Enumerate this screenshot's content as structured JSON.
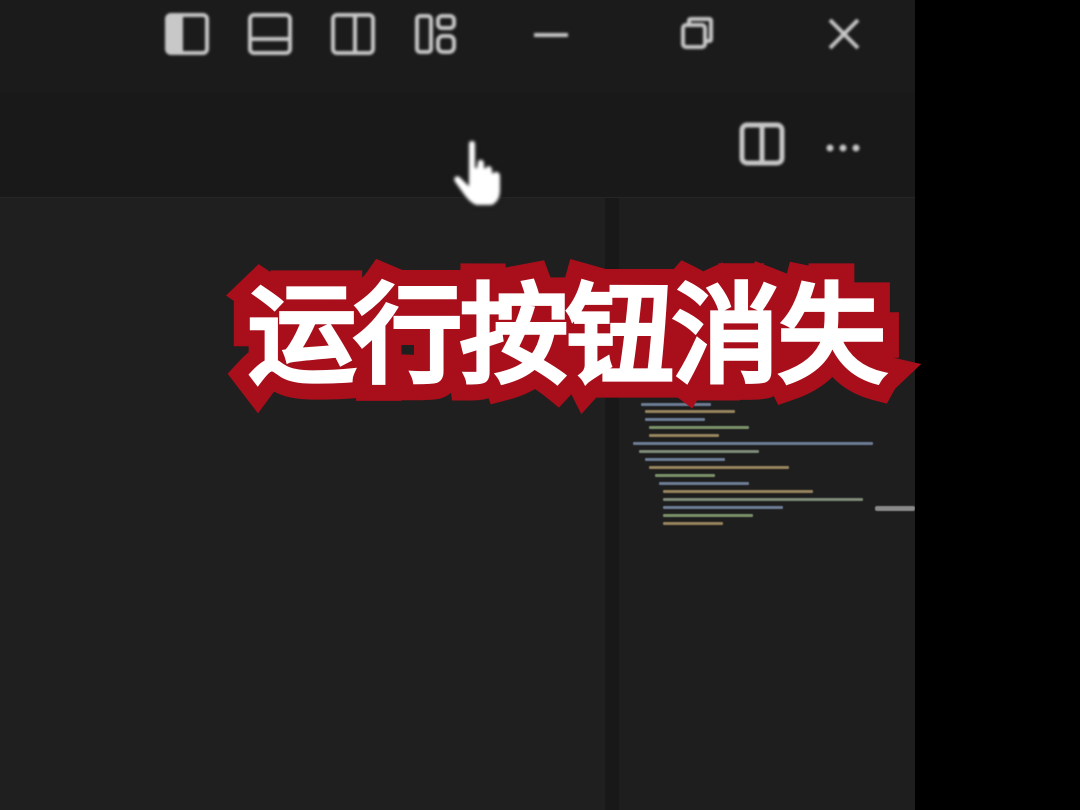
{
  "caption": {
    "text": "运行按钮消失",
    "fill_color": "#ffffff",
    "outline_color": "#a80f1b"
  },
  "window_controls": {
    "icons": [
      "toggle-primary-sidebar-icon",
      "toggle-panel-icon",
      "toggle-secondary-sidebar-icon",
      "customize-layout-icon",
      "minimize-icon",
      "restore-icon",
      "close-icon"
    ]
  },
  "editor_toolbar": {
    "icons": [
      "split-editor-icon",
      "more-actions-icon"
    ]
  },
  "colors": {
    "titlebar": "#1b1b1b",
    "tabbar": "#191919",
    "editor": "#1f1f1f",
    "outside": "#000000",
    "icon": "#c8c8c8"
  }
}
